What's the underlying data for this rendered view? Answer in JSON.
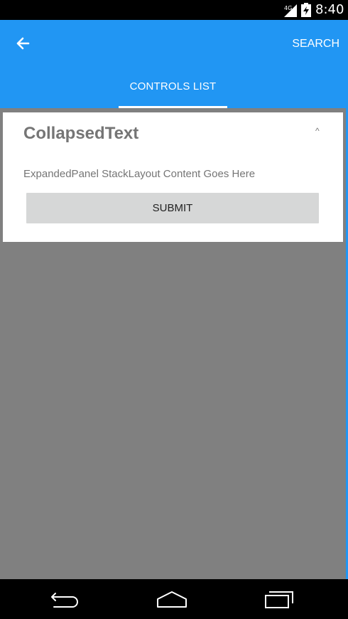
{
  "status_bar": {
    "network": "4G",
    "time": "8:40"
  },
  "toolbar": {
    "search_label": "SEARCH"
  },
  "tabs": [
    {
      "label": "CONTROLS LIST",
      "selected": true
    }
  ],
  "panel": {
    "title": "CollapsedText",
    "arrow": "^",
    "content": "ExpandedPanel StackLayout Content Goes Here",
    "submit_label": "SUBMIT"
  },
  "colors": {
    "app_bar": "#2196F3",
    "status_bar": "#000000",
    "backdrop": "#808080",
    "panel": "#ffffff",
    "title_text": "#757575",
    "button": "#d6d7d7"
  },
  "icons": {
    "back": "arrow-back-icon",
    "nav_back": "nav-back-icon",
    "nav_home": "nav-home-icon",
    "nav_recents": "nav-recents-icon"
  }
}
